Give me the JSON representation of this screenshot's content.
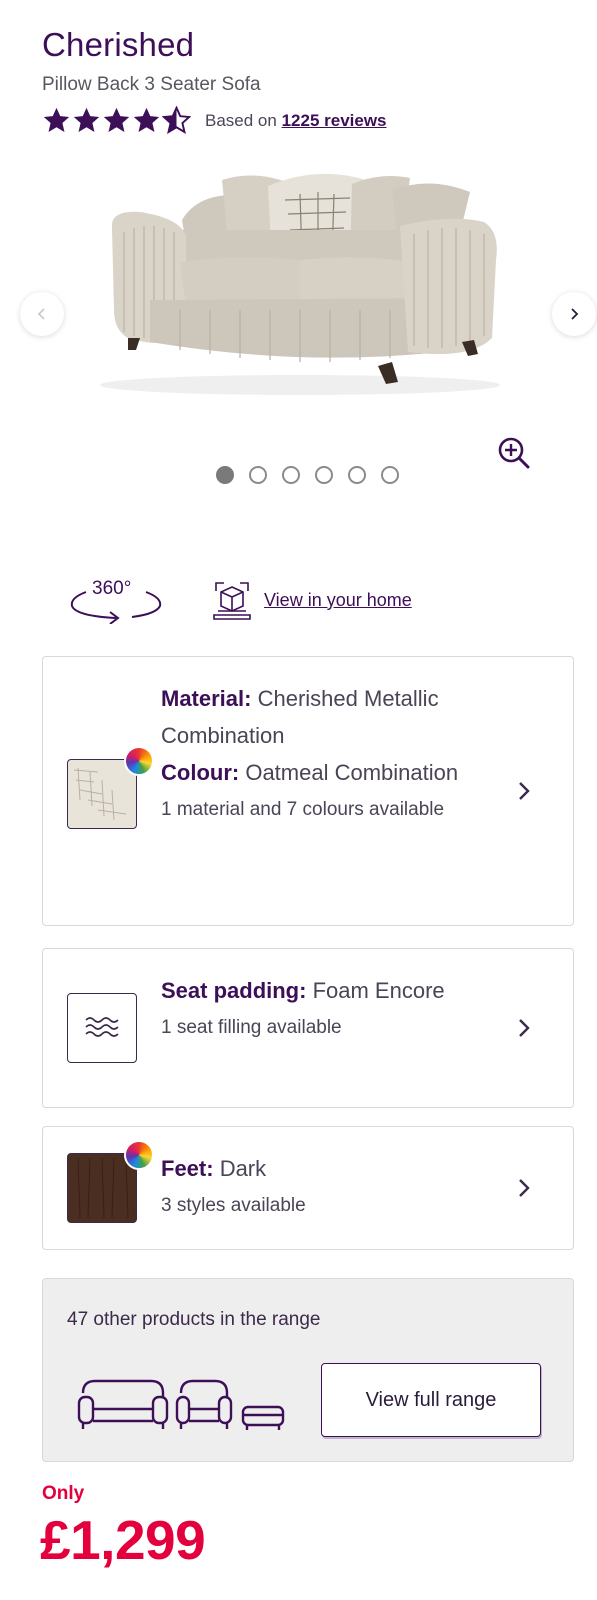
{
  "product": {
    "title": "Cherished",
    "subtitle": "Pillow Back 3 Seater Sofa",
    "rating": 4.5,
    "rating_prefix": "Based on",
    "reviews_link": "1225 reviews"
  },
  "gallery": {
    "image_alt": "Cherished Pillow Back 3 Seater Sofa in Oatmeal",
    "prev_icon": "chevron-left-icon",
    "next_icon": "chevron-right-icon",
    "zoom_icon": "zoom-in-icon",
    "dots": 6,
    "active_dot": 0
  },
  "tools": {
    "spin_label": "360°",
    "ar_link": "View in your home"
  },
  "options": {
    "material": {
      "material_label": "Material:",
      "material_value": "Cherished Metallic Combination",
      "colour_label": "Colour:",
      "colour_value": "Oatmeal Combination",
      "availability": "1 material and 7 colours available"
    },
    "seat": {
      "label": "Seat padding:",
      "value": "Foam Encore",
      "availability": "1 seat filling available"
    },
    "feet": {
      "label": "Feet:",
      "value": "Dark",
      "availability": "3 styles available"
    }
  },
  "range": {
    "count_text": "47 other products in the range",
    "button_label": "View full range"
  },
  "price": {
    "only_label": "Only",
    "amount": "£1,299"
  },
  "colors": {
    "brand_purple": "#3c0f57",
    "price_red": "#e4003c",
    "card_border": "#dad7de",
    "range_bg": "#efeeef"
  }
}
